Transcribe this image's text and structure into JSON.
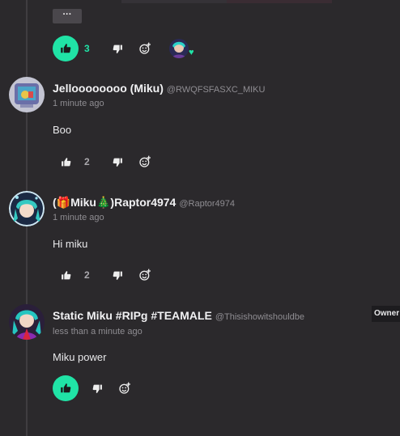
{
  "top": {
    "more_label": "···",
    "likes": "3"
  },
  "comments": [
    {
      "name": "Jelloooooooo (Miku)",
      "handle": "@RWQFSFASXC_MIKU",
      "time": "1 minute ago",
      "body": "Boo",
      "likes": "2"
    },
    {
      "name": "(🎁Miku🎄)Raptor4974",
      "handle": "@Raptor4974",
      "time": "1 minute ago",
      "body": "Hi miku",
      "likes": "2"
    },
    {
      "name": "Static Miku #RIPg #TEAMALE",
      "handle": "@Thisishowitshouldbe",
      "time": "less than a minute ago",
      "body": "Miku power",
      "badge": "Owner"
    }
  ],
  "icons": {
    "like": "thumbs-up-icon",
    "dislike": "thumbs-down-icon",
    "react": "add-reaction-icon",
    "reacted": "heart-icon"
  },
  "colors": {
    "accent": "#20e3a6",
    "background": "#2b292c",
    "muted_text": "#8f8d92"
  }
}
